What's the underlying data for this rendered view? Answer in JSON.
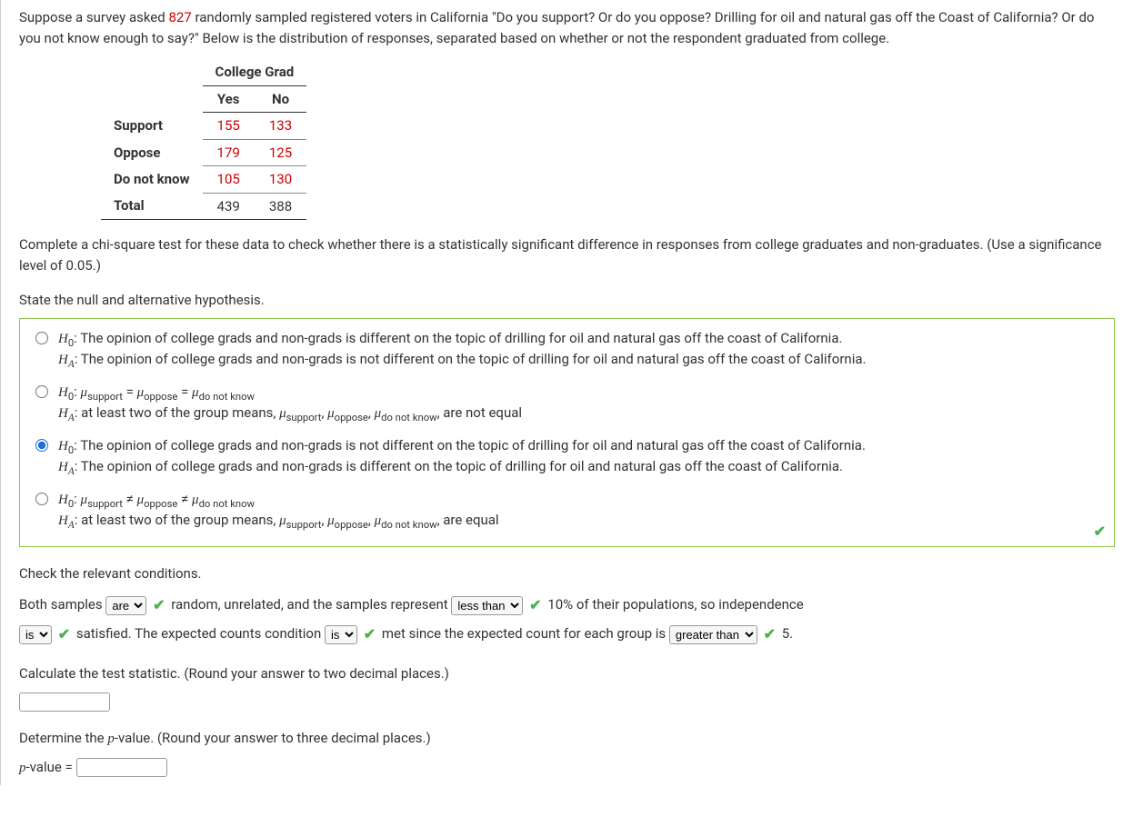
{
  "intro": {
    "before_num": "Suppose a survey asked ",
    "num": "827",
    "after_num": " randomly sampled registered voters in California \"Do you support? Or do you oppose? Drilling for oil and natural gas off the Coast of California? Or do you not know enough to say?\" Below is the distribution of responses, separated based on whether or not the respondent graduated from college."
  },
  "table": {
    "group_header": "College Grad",
    "col1": "Yes",
    "col2": "No",
    "rows": [
      {
        "label": "Support",
        "a": "155",
        "b": "133"
      },
      {
        "label": "Oppose",
        "a": "179",
        "b": "125"
      },
      {
        "label": "Do not know",
        "a": "105",
        "b": "130"
      },
      {
        "label": "Total",
        "a": "439",
        "b": "388"
      }
    ]
  },
  "q_complete": "Complete a chi-square test for these data to check whether there is a statistically significant difference in responses from college graduates and non-graduates. (Use a significance level of 0.05.)",
  "q_state": "State the null and alternative hypothesis.",
  "options": {
    "opt1_h0": ": The opinion of college grads and non-grads is different on the topic of drilling for oil and natural gas off the coast of California.",
    "opt1_ha": ": The opinion of college grads and non-grads is not different on the topic of drilling for oil and natural gas off the coast of California.",
    "opt2_ha": ": at least two of the group means, ",
    "opt2_ha_end": " are not equal",
    "opt3_h0": ": The opinion of college grads and non-grads is not different on the topic of drilling for oil and natural gas off the coast of California.",
    "opt3_ha": ": The opinion of college grads and non-grads is different on the topic of drilling for oil and natural gas off the coast of California.",
    "opt4_ha": ": at least two of the group means, ",
    "opt4_ha_end": " are equal",
    "mu_support": "support",
    "mu_oppose": "oppose",
    "mu_dnk": "do not know"
  },
  "check_conditions": "Check the relevant conditions.",
  "conditions": {
    "t1": "Both samples ",
    "sel1": "are",
    "t2": " random, unrelated, and the samples represent ",
    "sel2": "less than",
    "t3": " 10% of their populations, so independence ",
    "sel3": "is",
    "t4": " satisfied. The expected counts condition ",
    "sel4": "is",
    "t5": " met since the expected count for each group is ",
    "sel5": "greater than",
    "t6": " 5."
  },
  "calc_stat": "Calculate the test statistic. (Round your answer to two decimal places.)",
  "det_pvalue": "Determine the ",
  "pvalue_word": "p",
  "det_pvalue_end": "-value. (Round your answer to three decimal places.)",
  "pval_label_pre": "p",
  "pval_label_post": "-value = "
}
